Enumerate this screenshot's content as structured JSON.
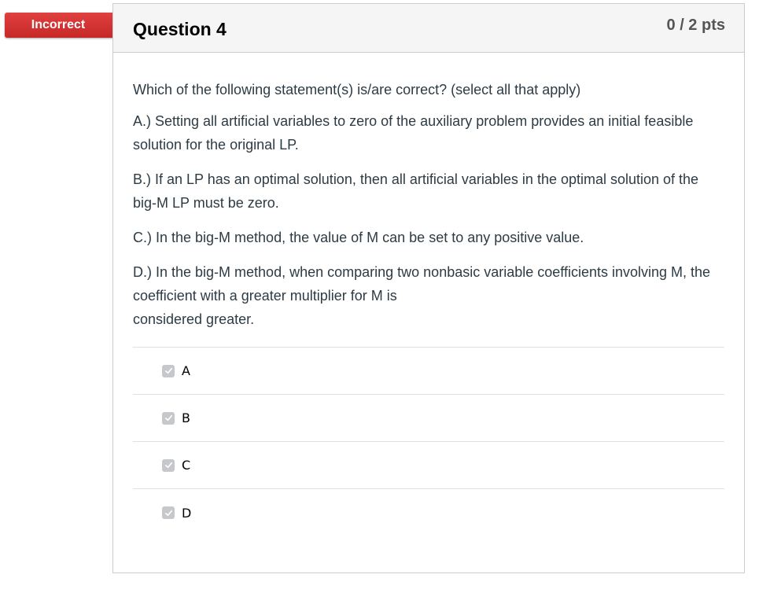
{
  "badge": {
    "label": "Incorrect",
    "color": "#d13b3a"
  },
  "question": {
    "title": "Question 4",
    "points": "0 / 2 pts",
    "prompt": "Which of the following statement(s) is/are correct? (select all that apply)",
    "statements": [
      "A.) Setting all artificial variables to zero of the auxiliary problem provides an initial feasible solution for the original LP.",
      "B.) If an LP has an optimal solution, then all artificial variables in the optimal solution of the big-M LP must be zero.",
      "C.) In the big-M method, the value of M can be set to any positive value.",
      "D.) In the big-M method, when comparing two nonbasic variable coefficients involving M, the coefficient with a greater multiplier for M is",
      "considered greater."
    ]
  },
  "answers": [
    {
      "label": "A",
      "checked": true,
      "icon": "check-icon"
    },
    {
      "label": "B",
      "checked": true,
      "icon": "check-icon"
    },
    {
      "label": "C",
      "checked": true,
      "icon": "check-icon"
    },
    {
      "label": "D",
      "checked": true,
      "icon": "check-icon"
    }
  ]
}
